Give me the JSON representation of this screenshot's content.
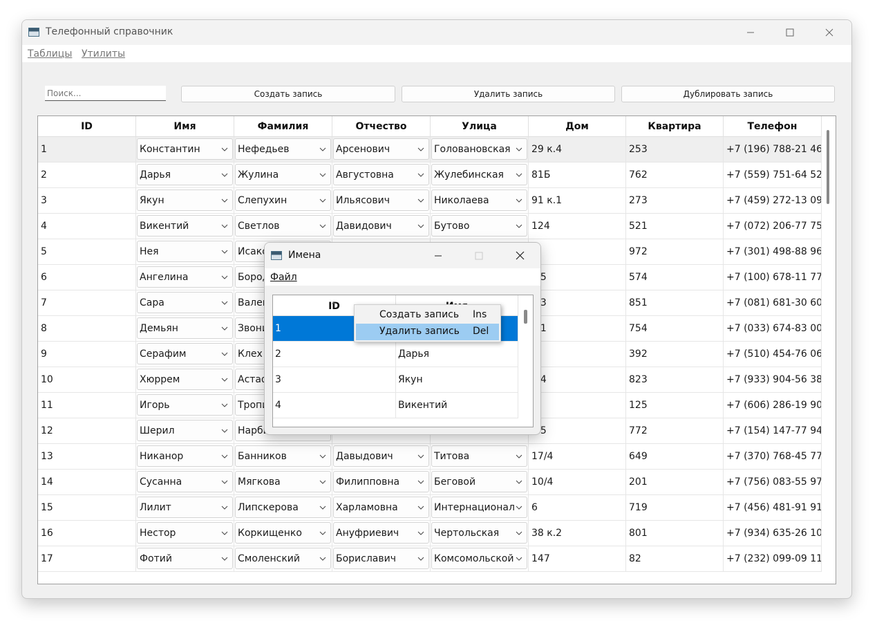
{
  "main_window": {
    "title": "Телефонный справочник",
    "menu": [
      "Таблицы",
      "Утилиты"
    ],
    "search_placeholder": "Поиск...",
    "buttons": {
      "create": "Создать запись",
      "delete": "Удалить запись",
      "duplicate": "Дублировать запись"
    },
    "columns": [
      "ID",
      "Имя",
      "Фамилия",
      "Отчество",
      "Улица",
      "Дом",
      "Квартира",
      "Телефон"
    ],
    "rows": [
      [
        "1",
        "Константин",
        "Нефедьев",
        "Арсенович",
        "Голованoвская",
        "29 к.4",
        "253",
        "+7 (196) 788-21 46"
      ],
      [
        "2",
        "Дарья",
        "Жулина",
        "Августовна",
        "Жулебинская",
        "81Б",
        "762",
        "+7 (559) 751-64 52"
      ],
      [
        "3",
        "Якун",
        "Слепухин",
        "Ильясович",
        "Николаева",
        "91 к.1",
        "273",
        "+7 (459) 272-13 09"
      ],
      [
        "4",
        "Викентий",
        "Светлов",
        "Давидович",
        "Бутово",
        "124",
        "521",
        "+7 (072) 206-77 75"
      ],
      [
        "5",
        "Нея",
        "Исако",
        "",
        "",
        "/8",
        "972",
        "+7 (301) 498-88 96"
      ],
      [
        "6",
        "Ангелина",
        "Бород",
        "",
        "",
        "к.5",
        "574",
        "+7 (100) 678-11 77"
      ],
      [
        "7",
        "Сара",
        "Вален",
        "",
        "",
        "к.3",
        "851",
        "+7 (081) 681-30 60"
      ],
      [
        "8",
        "Демьян",
        "Звони",
        "",
        "",
        "к.1",
        "754",
        "+7 (033) 674-83 00"
      ],
      [
        "9",
        "Серафим",
        "Клех",
        "",
        "",
        "Г",
        "392",
        "+7 (510) 454-76 06"
      ],
      [
        "10",
        "Хюррем",
        "Астаф",
        "",
        "",
        "к.4",
        "823",
        "+7 (933) 904-56 38"
      ],
      [
        "11",
        "Игорь",
        "Тропи",
        "",
        "",
        "/1",
        "125",
        "+7 (606) 286-19 90"
      ],
      [
        "12",
        "Шерил",
        "Нарби",
        "",
        "",
        "к.5",
        "772",
        "+7 (154) 147-77 94"
      ],
      [
        "13",
        "Никанор",
        "Банников",
        "Давыдович",
        "Титова",
        "17/4",
        "649",
        "+7 (370) 768-45 77"
      ],
      [
        "14",
        "Сусанна",
        "Мягкова",
        "Филипповна",
        "Беговой",
        "10/4",
        "201",
        "+7 (756) 083-55 97"
      ],
      [
        "15",
        "Лилит",
        "Липскерова",
        "Харламовна",
        "Интернационал",
        "6",
        "719",
        "+7 (456) 481-91 91"
      ],
      [
        "16",
        "Нестор",
        "Коркищенко",
        "Ануфриевич",
        "Чертольская",
        "38 к.2",
        "801",
        "+7 (934) 635-26 10"
      ],
      [
        "17",
        "Фотий",
        "Смоленский",
        "Бориславич",
        "Комсомольской",
        "147",
        "82",
        "+7 (232) 099-09 11"
      ]
    ]
  },
  "dialog": {
    "title": "Имена",
    "menu": [
      "Файл"
    ],
    "columns": [
      "ID",
      "Имя"
    ],
    "rows": [
      [
        "1",
        ""
      ],
      [
        "2",
        "Дарья"
      ],
      [
        "3",
        "Якун"
      ],
      [
        "4",
        "Викентий"
      ]
    ]
  },
  "context_menu": {
    "items": [
      {
        "label": "Создать запись",
        "shortcut": "Ins"
      },
      {
        "label": "Удалить запись",
        "shortcut": "Del"
      }
    ]
  },
  "colors": {
    "selection": "#0078d7",
    "menu_highlight": "#9cccf2"
  }
}
